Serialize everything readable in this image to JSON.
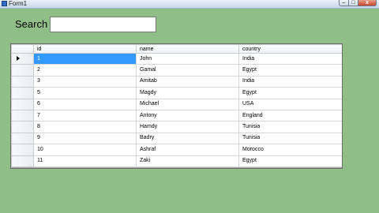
{
  "window": {
    "title": "Form1",
    "icon": "form-icon",
    "minimize_label": "–",
    "maximize_label": "□",
    "close_label": "x"
  },
  "search": {
    "label": "Search",
    "value": "",
    "placeholder": ""
  },
  "grid": {
    "columns": [
      "id",
      "name",
      "country"
    ],
    "current_row_icon": "row-pointer-icon",
    "rows": [
      {
        "id": "1",
        "name": "John",
        "country": "India"
      },
      {
        "id": "2",
        "name": "Gamal",
        "country": "Egypt"
      },
      {
        "id": "3",
        "name": "Amitab",
        "country": "India"
      },
      {
        "id": "5",
        "name": "Magdy",
        "country": "Egypt"
      },
      {
        "id": "6",
        "name": "Michael",
        "country": "USA"
      },
      {
        "id": "7",
        "name": "Antony",
        "country": "England"
      },
      {
        "id": "8",
        "name": "Hamdy",
        "country": "Tunisia"
      },
      {
        "id": "9",
        "name": "Badry",
        "country": "Tunisia"
      },
      {
        "id": "10",
        "name": "Ashraf",
        "country": "Morocco"
      },
      {
        "id": "11",
        "name": "Zaki",
        "country": "Egypt"
      }
    ]
  },
  "colors": {
    "form_background": "#8fbe87",
    "selection": "#3399ff",
    "grid_background": "#ababab"
  }
}
